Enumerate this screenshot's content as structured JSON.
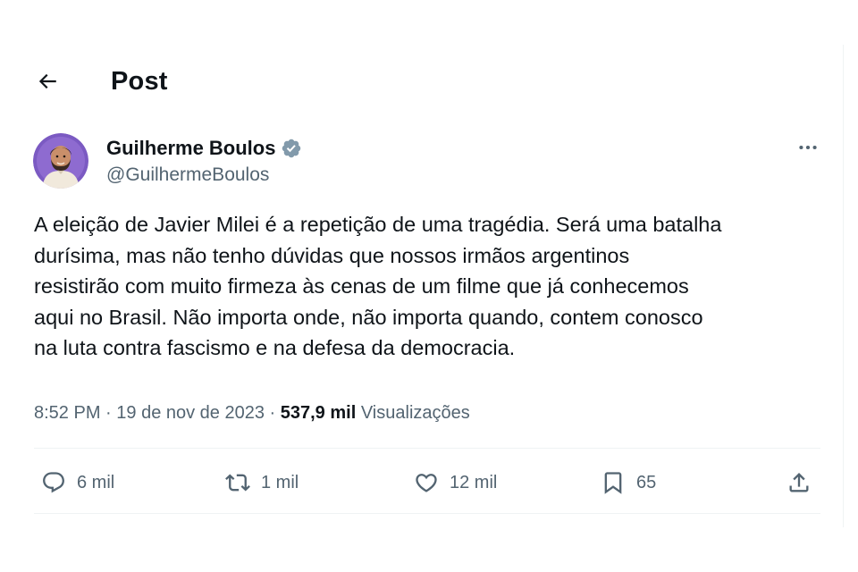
{
  "header": {
    "title": "Post",
    "back_icon": "arrow-left-icon"
  },
  "author": {
    "display_name": "Guilherme Boulos",
    "handle": "@GuilhermeBoulos",
    "verified_icon": "verified-badge-icon",
    "verified_color": "#829aab",
    "avatar_bg": "#7b5ac2"
  },
  "tweet": {
    "text": "A eleição de Javier Milei é a repetição de uma tragédia. Será uma batalha\ndurísima, mas não tenho dúvidas que nossos irmãos argentinos\nresistirão com muito firmeza às cenas de um filme que já conhecemos\naqui no Brasil. Não importa onde, não importa quando, contem conosco\nna luta contra  fascismo e na defesa da democracia.",
    "time": "8:52 PM",
    "separator": " · ",
    "date": "19 de nov de 2023",
    "views_count": "537,9 mil",
    "views_label": "Visualizações"
  },
  "actions": {
    "replies": {
      "icon": "reply-icon",
      "count": "6 mil"
    },
    "reposts": {
      "icon": "repost-icon",
      "count": "1 mil"
    },
    "likes": {
      "icon": "heart-icon",
      "count": "12 mil"
    },
    "bookmarks": {
      "icon": "bookmark-icon",
      "count": "65"
    },
    "share": {
      "icon": "share-icon"
    }
  },
  "colors": {
    "text": "#0f1419",
    "secondary": "#536471",
    "divider": "#eff3f4"
  }
}
